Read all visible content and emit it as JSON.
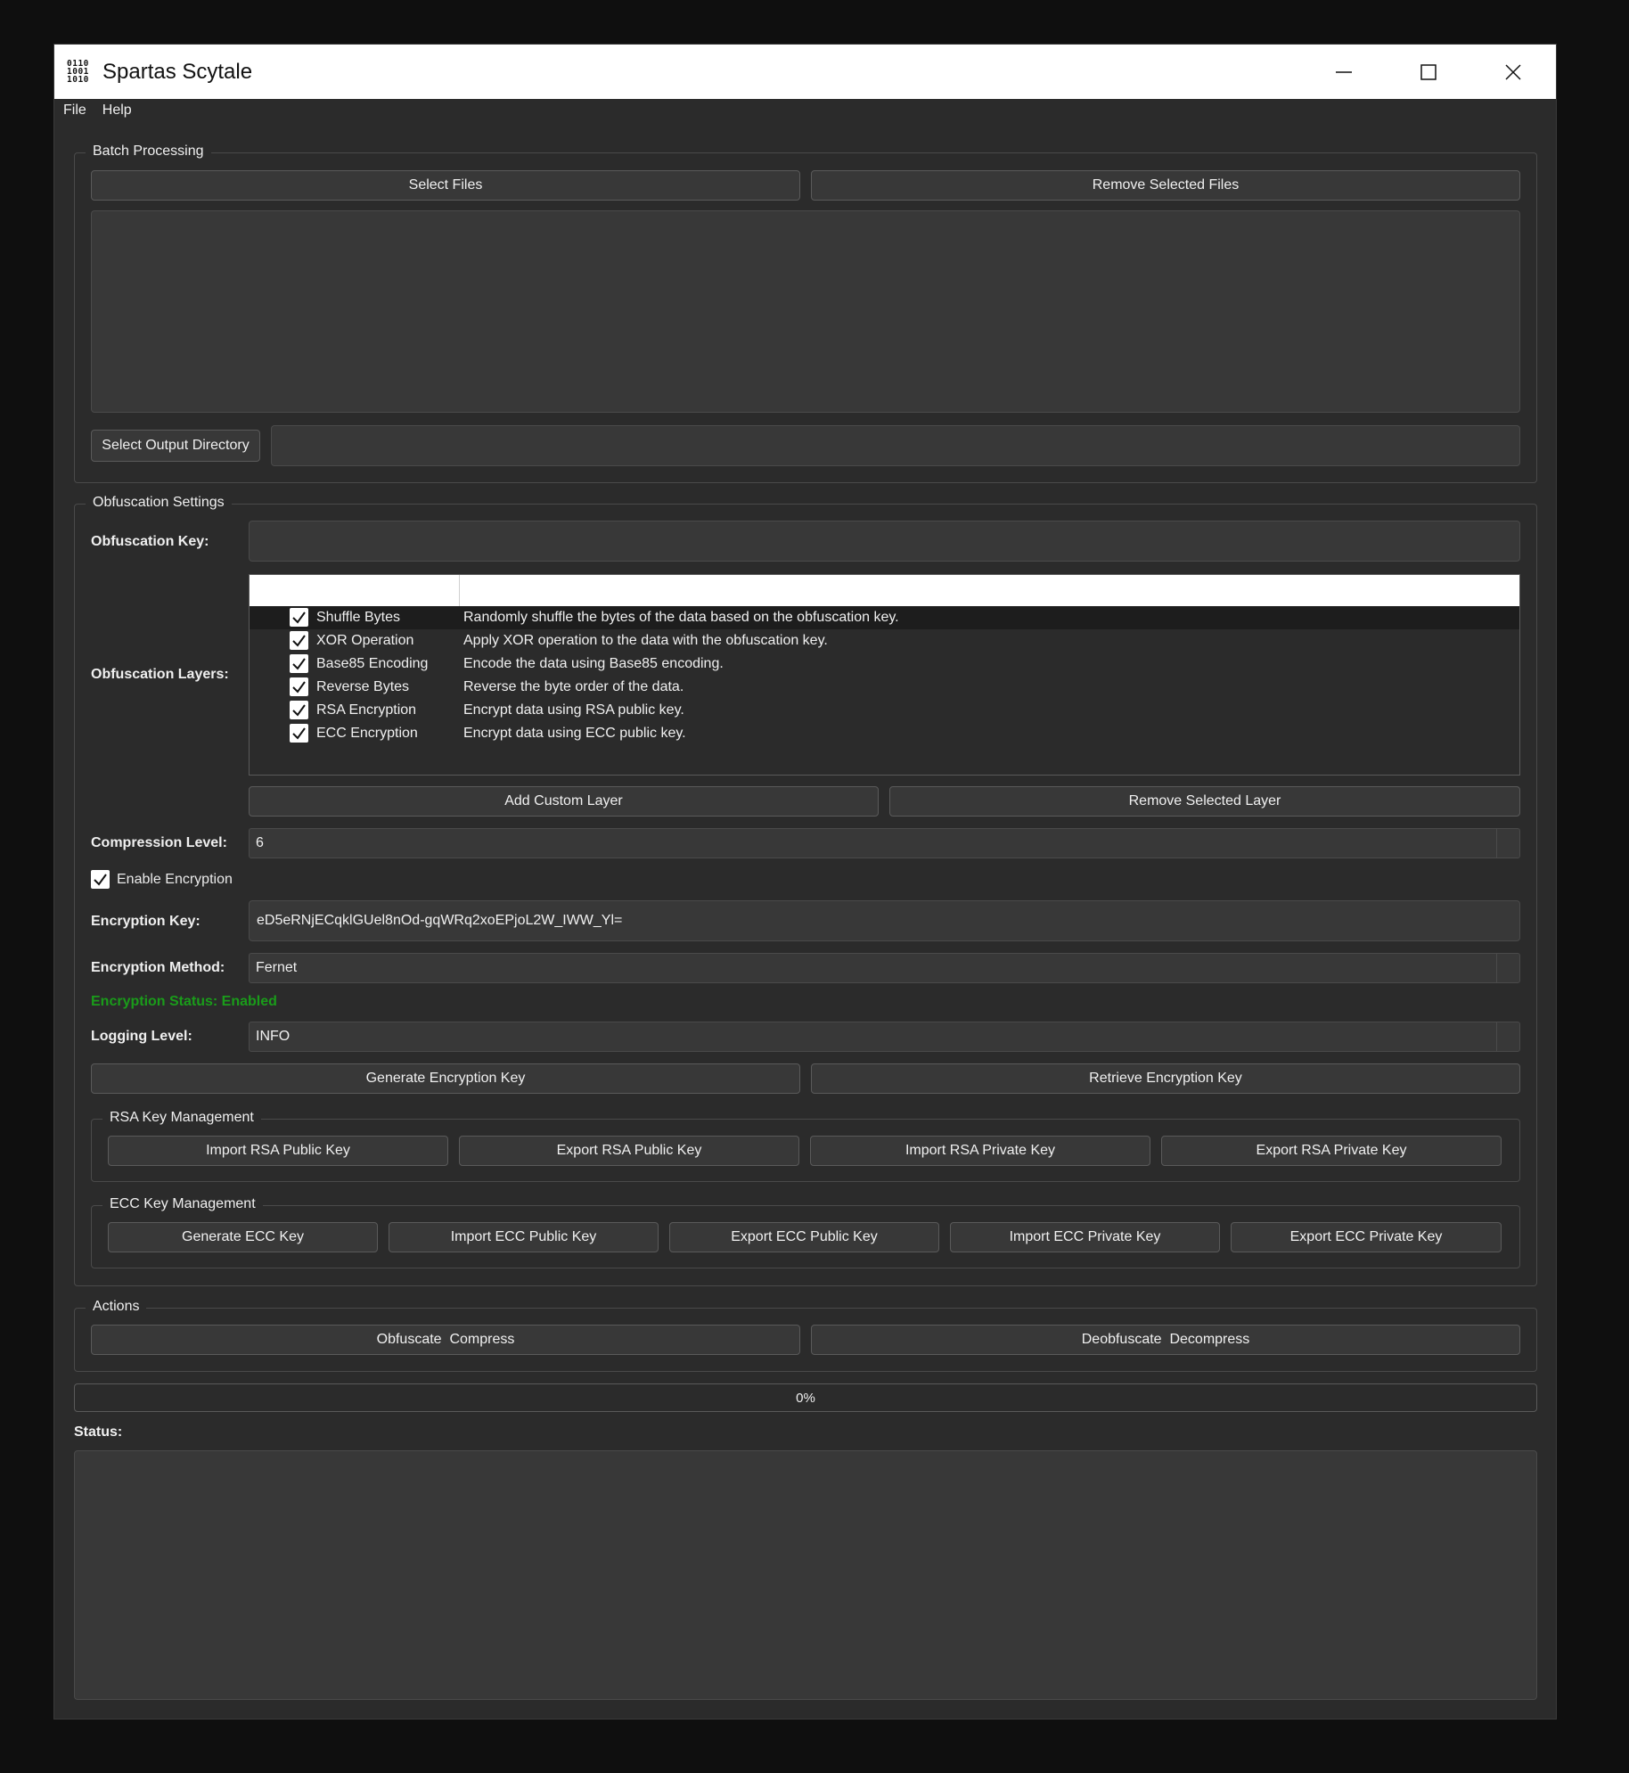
{
  "window": {
    "title": "Spartas Scytale",
    "icon_text": [
      "0110",
      "1001",
      "1010"
    ]
  },
  "menu": [
    "File",
    "Help"
  ],
  "batch": {
    "title": "Batch Processing",
    "select_files": "Select Files",
    "remove_files": "Remove Selected Files",
    "select_output": "Select Output Directory",
    "output_path": ""
  },
  "obfuscation": {
    "title": "Obfuscation Settings",
    "key_label": "Obfuscation Key:",
    "key_value": "",
    "layers_label": "Obfuscation Layers:",
    "layers": [
      {
        "name": "Shuffle Bytes",
        "desc": "Randomly shuffle the bytes of the data based on the obfuscation key.",
        "checked": true
      },
      {
        "name": "XOR Operation",
        "desc": "Apply XOR operation to the data with the obfuscation key.",
        "checked": true
      },
      {
        "name": "Base85 Encoding",
        "desc": "Encode the data using Base85 encoding.",
        "checked": true
      },
      {
        "name": "Reverse Bytes",
        "desc": "Reverse the byte order of the data.",
        "checked": true
      },
      {
        "name": "RSA Encryption",
        "desc": "Encrypt data using RSA public key.",
        "checked": true
      },
      {
        "name": "ECC Encryption",
        "desc": "Encrypt data using ECC public key.",
        "checked": true
      }
    ],
    "add_layer": "Add Custom Layer",
    "remove_layer": "Remove Selected Layer",
    "compression_label": "Compression Level:",
    "compression_value": "6",
    "enable_encryption": "Enable Encryption",
    "encryption_key_label": "Encryption Key:",
    "encryption_key_value": "eD5eRNjECqklGUel8nOd-gqWRq2xoEPjoL2W_IWW_Yl=",
    "encryption_method_label": "Encryption Method:",
    "encryption_method_value": "Fernet",
    "encryption_status": "Encryption Status: Enabled",
    "logging_label": "Logging Level:",
    "logging_value": "INFO",
    "generate_key": "Generate Encryption Key",
    "retrieve_key": "Retrieve Encryption Key"
  },
  "rsa": {
    "title": "RSA Key Management",
    "buttons": [
      "Import RSA Public Key",
      "Export RSA Public Key",
      "Import RSA Private Key",
      "Export RSA Private Key"
    ]
  },
  "ecc": {
    "title": "ECC Key Management",
    "buttons": [
      "Generate ECC Key",
      "Import ECC Public Key",
      "Export ECC Public Key",
      "Import ECC Private Key",
      "Export ECC Private Key"
    ]
  },
  "actions": {
    "title": "Actions",
    "obfuscate": "Obfuscate  Compress",
    "deobfuscate": "Deobfuscate  Decompress"
  },
  "progress": {
    "value": 0,
    "text": "0%"
  },
  "status_label": "Status:",
  "colors": {
    "status_green": "#1a9c1a",
    "background": "#2b2b2b"
  }
}
